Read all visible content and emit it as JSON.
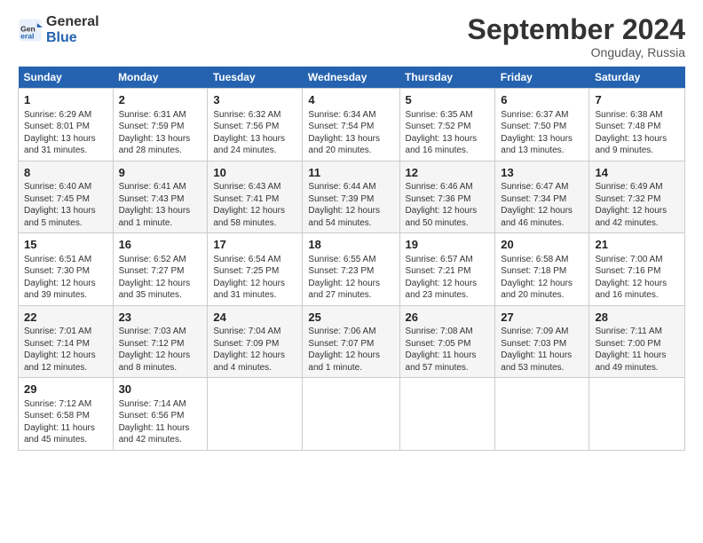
{
  "header": {
    "logo_line1": "General",
    "logo_line2": "Blue",
    "month_title": "September 2024",
    "location": "Onguday, Russia"
  },
  "weekdays": [
    "Sunday",
    "Monday",
    "Tuesday",
    "Wednesday",
    "Thursday",
    "Friday",
    "Saturday"
  ],
  "weeks": [
    [
      {
        "day": "1",
        "info": "Sunrise: 6:29 AM\nSunset: 8:01 PM\nDaylight: 13 hours\nand 31 minutes."
      },
      {
        "day": "2",
        "info": "Sunrise: 6:31 AM\nSunset: 7:59 PM\nDaylight: 13 hours\nand 28 minutes."
      },
      {
        "day": "3",
        "info": "Sunrise: 6:32 AM\nSunset: 7:56 PM\nDaylight: 13 hours\nand 24 minutes."
      },
      {
        "day": "4",
        "info": "Sunrise: 6:34 AM\nSunset: 7:54 PM\nDaylight: 13 hours\nand 20 minutes."
      },
      {
        "day": "5",
        "info": "Sunrise: 6:35 AM\nSunset: 7:52 PM\nDaylight: 13 hours\nand 16 minutes."
      },
      {
        "day": "6",
        "info": "Sunrise: 6:37 AM\nSunset: 7:50 PM\nDaylight: 13 hours\nand 13 minutes."
      },
      {
        "day": "7",
        "info": "Sunrise: 6:38 AM\nSunset: 7:48 PM\nDaylight: 13 hours\nand 9 minutes."
      }
    ],
    [
      {
        "day": "8",
        "info": "Sunrise: 6:40 AM\nSunset: 7:45 PM\nDaylight: 13 hours\nand 5 minutes."
      },
      {
        "day": "9",
        "info": "Sunrise: 6:41 AM\nSunset: 7:43 PM\nDaylight: 13 hours\nand 1 minute."
      },
      {
        "day": "10",
        "info": "Sunrise: 6:43 AM\nSunset: 7:41 PM\nDaylight: 12 hours\nand 58 minutes."
      },
      {
        "day": "11",
        "info": "Sunrise: 6:44 AM\nSunset: 7:39 PM\nDaylight: 12 hours\nand 54 minutes."
      },
      {
        "day": "12",
        "info": "Sunrise: 6:46 AM\nSunset: 7:36 PM\nDaylight: 12 hours\nand 50 minutes."
      },
      {
        "day": "13",
        "info": "Sunrise: 6:47 AM\nSunset: 7:34 PM\nDaylight: 12 hours\nand 46 minutes."
      },
      {
        "day": "14",
        "info": "Sunrise: 6:49 AM\nSunset: 7:32 PM\nDaylight: 12 hours\nand 42 minutes."
      }
    ],
    [
      {
        "day": "15",
        "info": "Sunrise: 6:51 AM\nSunset: 7:30 PM\nDaylight: 12 hours\nand 39 minutes."
      },
      {
        "day": "16",
        "info": "Sunrise: 6:52 AM\nSunset: 7:27 PM\nDaylight: 12 hours\nand 35 minutes."
      },
      {
        "day": "17",
        "info": "Sunrise: 6:54 AM\nSunset: 7:25 PM\nDaylight: 12 hours\nand 31 minutes."
      },
      {
        "day": "18",
        "info": "Sunrise: 6:55 AM\nSunset: 7:23 PM\nDaylight: 12 hours\nand 27 minutes."
      },
      {
        "day": "19",
        "info": "Sunrise: 6:57 AM\nSunset: 7:21 PM\nDaylight: 12 hours\nand 23 minutes."
      },
      {
        "day": "20",
        "info": "Sunrise: 6:58 AM\nSunset: 7:18 PM\nDaylight: 12 hours\nand 20 minutes."
      },
      {
        "day": "21",
        "info": "Sunrise: 7:00 AM\nSunset: 7:16 PM\nDaylight: 12 hours\nand 16 minutes."
      }
    ],
    [
      {
        "day": "22",
        "info": "Sunrise: 7:01 AM\nSunset: 7:14 PM\nDaylight: 12 hours\nand 12 minutes."
      },
      {
        "day": "23",
        "info": "Sunrise: 7:03 AM\nSunset: 7:12 PM\nDaylight: 12 hours\nand 8 minutes."
      },
      {
        "day": "24",
        "info": "Sunrise: 7:04 AM\nSunset: 7:09 PM\nDaylight: 12 hours\nand 4 minutes."
      },
      {
        "day": "25",
        "info": "Sunrise: 7:06 AM\nSunset: 7:07 PM\nDaylight: 12 hours\nand 1 minute."
      },
      {
        "day": "26",
        "info": "Sunrise: 7:08 AM\nSunset: 7:05 PM\nDaylight: 11 hours\nand 57 minutes."
      },
      {
        "day": "27",
        "info": "Sunrise: 7:09 AM\nSunset: 7:03 PM\nDaylight: 11 hours\nand 53 minutes."
      },
      {
        "day": "28",
        "info": "Sunrise: 7:11 AM\nSunset: 7:00 PM\nDaylight: 11 hours\nand 49 minutes."
      }
    ],
    [
      {
        "day": "29",
        "info": "Sunrise: 7:12 AM\nSunset: 6:58 PM\nDaylight: 11 hours\nand 45 minutes."
      },
      {
        "day": "30",
        "info": "Sunrise: 7:14 AM\nSunset: 6:56 PM\nDaylight: 11 hours\nand 42 minutes."
      },
      {
        "day": "",
        "info": ""
      },
      {
        "day": "",
        "info": ""
      },
      {
        "day": "",
        "info": ""
      },
      {
        "day": "",
        "info": ""
      },
      {
        "day": "",
        "info": ""
      }
    ]
  ]
}
